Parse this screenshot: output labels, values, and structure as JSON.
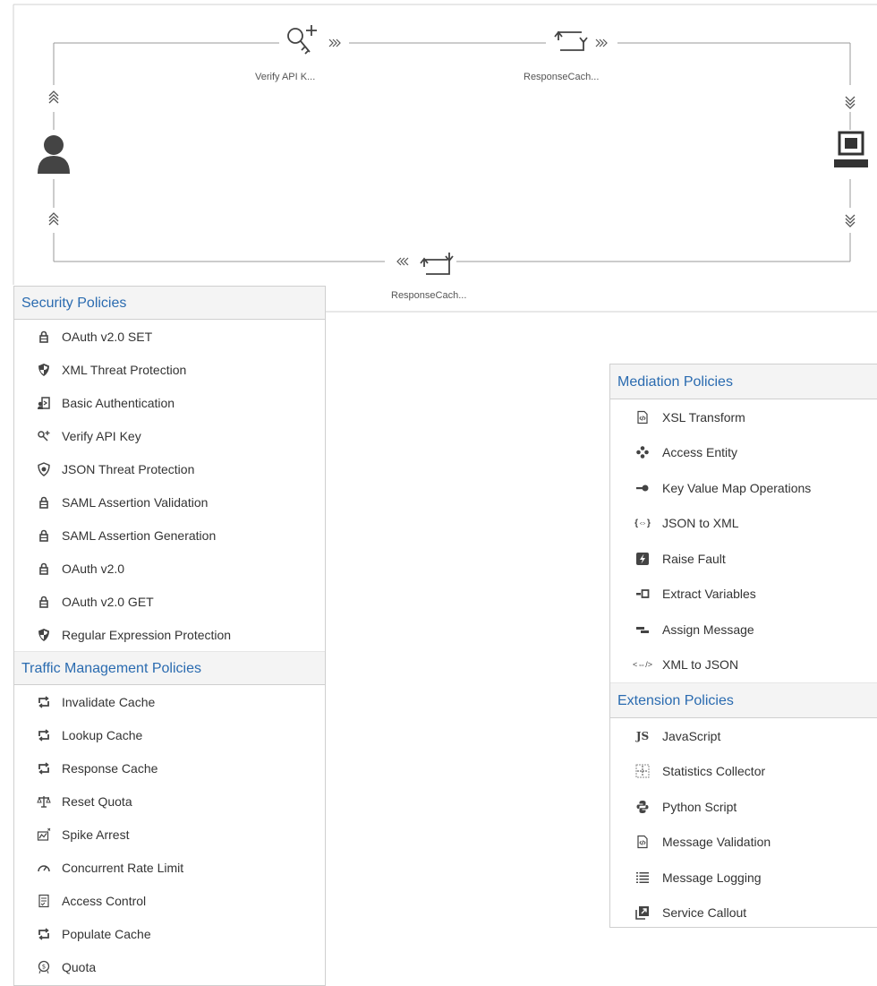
{
  "flow": {
    "request_policies": [
      {
        "label": "Verify API K...",
        "icon": "verify-key-icon"
      },
      {
        "label": "ResponseCach...",
        "icon": "cache-icon"
      }
    ],
    "response_policies": [
      {
        "label": "ResponseCach...",
        "icon": "cache-icon"
      }
    ],
    "client_icon": "user-icon",
    "backend_icon": "laptop-icon"
  },
  "left_panel": {
    "sections": [
      {
        "title": "Security Policies",
        "items": [
          {
            "label": "OAuth v2.0 SET",
            "icon": "lock-icon"
          },
          {
            "label": "XML Threat Protection",
            "icon": "shield-icon"
          },
          {
            "label": "Basic Authentication",
            "icon": "login-icon"
          },
          {
            "label": "Verify API Key",
            "icon": "key-icon"
          },
          {
            "label": "JSON Threat Protection",
            "icon": "badge-icon"
          },
          {
            "label": "SAML Assertion Validation",
            "icon": "lock-icon"
          },
          {
            "label": "SAML Assertion Generation",
            "icon": "lock-icon"
          },
          {
            "label": "OAuth v2.0",
            "icon": "lock-icon"
          },
          {
            "label": "OAuth v2.0 GET",
            "icon": "lock-icon"
          },
          {
            "label": "Regular Expression Protection",
            "icon": "shield-icon"
          }
        ]
      },
      {
        "title": "Traffic Management Policies",
        "items": [
          {
            "label": "Invalidate Cache",
            "icon": "cache-icon"
          },
          {
            "label": "Lookup Cache",
            "icon": "cache-icon"
          },
          {
            "label": "Response Cache",
            "icon": "cache-icon"
          },
          {
            "label": "Reset Quota",
            "icon": "scale-icon"
          },
          {
            "label": "Spike Arrest",
            "icon": "chart-icon"
          },
          {
            "label": "Concurrent Rate Limit",
            "icon": "gauge-icon"
          },
          {
            "label": "Access Control",
            "icon": "checklist-icon"
          },
          {
            "label": "Populate Cache",
            "icon": "cache-icon"
          },
          {
            "label": "Quota",
            "icon": "quota-icon"
          }
        ]
      }
    ]
  },
  "right_panel": {
    "sections": [
      {
        "title": "Mediation Policies",
        "items": [
          {
            "label": "XSL Transform",
            "icon": "code-doc-icon"
          },
          {
            "label": "Access Entity",
            "icon": "entity-icon"
          },
          {
            "label": "Key Value Map Operations",
            "icon": "key-icon"
          },
          {
            "label": "JSON to XML",
            "icon": "json-icon"
          },
          {
            "label": "Raise Fault",
            "icon": "bolt-icon"
          },
          {
            "label": "Extract Variables",
            "icon": "extract-icon"
          },
          {
            "label": "Assign Message",
            "icon": "assign-icon"
          },
          {
            "label": "XML to JSON",
            "icon": "xml-icon"
          }
        ]
      },
      {
        "title": "Extension Policies",
        "items": [
          {
            "label": "JavaScript",
            "icon": "js-icon"
          },
          {
            "label": "Statistics Collector",
            "icon": "stats-icon"
          },
          {
            "label": "Python Script",
            "icon": "python-icon"
          },
          {
            "label": "Message Validation",
            "icon": "code-doc-icon"
          },
          {
            "label": "Message Logging",
            "icon": "list-icon"
          },
          {
            "label": "Service Callout",
            "icon": "callout-icon"
          }
        ]
      }
    ]
  }
}
